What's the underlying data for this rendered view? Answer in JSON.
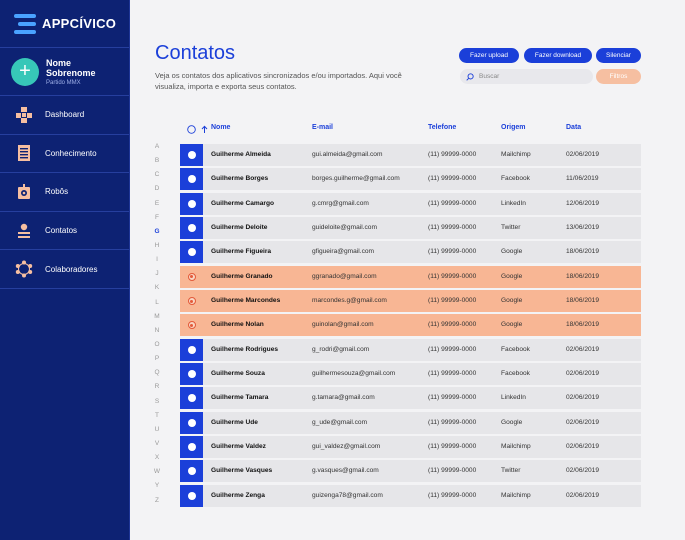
{
  "brand": {
    "name": "APPCÍVICO"
  },
  "profile": {
    "name": "Nome Sobrenome",
    "party": "Partido MMX"
  },
  "nav": [
    {
      "label": "Dashboard",
      "icon": "dashboard-icon"
    },
    {
      "label": "Conhecimento",
      "icon": "document-icon"
    },
    {
      "label": "Robôs",
      "icon": "robot-icon"
    },
    {
      "label": "Contatos",
      "icon": "contacts-icon"
    },
    {
      "label": "Colaboradores",
      "icon": "network-icon"
    }
  ],
  "page": {
    "title": "Contatos",
    "description": "Veja os contatos dos aplicativos sincronizados e/ou importados. Aqui você visualiza, importa e exporta seus contatos."
  },
  "actions": {
    "upload": "Fazer upload",
    "download": "Fazer download",
    "mute": "Silenciar",
    "filters": "Filtros"
  },
  "search": {
    "placeholder": "Buscar",
    "value": ""
  },
  "table": {
    "headers": {
      "name": "Nome",
      "email": "E-mail",
      "phone": "Telefone",
      "origin": "Origem",
      "date": "Data"
    },
    "sort_icon": "arrow-up-icon",
    "rows": [
      {
        "name": "Guilherme Almeida",
        "email": "gui.almeida@gmail.com",
        "phone": "(11) 99999-0000",
        "origin": "Mailchimp",
        "date": "02/06/2019",
        "selected": false
      },
      {
        "name": "Guilherme Borges",
        "email": "borges.guilherme@gmail.com",
        "phone": "(11) 99999-0000",
        "origin": "Facebook",
        "date": "11/06/2019",
        "selected": false
      },
      {
        "name": "Guilherme Camargo",
        "email": "g.cmrg@gmail.com",
        "phone": "(11) 99999-0000",
        "origin": "LinkedIn",
        "date": "12/06/2019",
        "selected": false
      },
      {
        "name": "Guilherme Deloite",
        "email": "guideloite@gmail.com",
        "phone": "(11) 99999-0000",
        "origin": "Twitter",
        "date": "13/06/2019",
        "selected": false
      },
      {
        "name": "Guilherme Figueira",
        "email": "gfigueira@gmail.com",
        "phone": "(11) 99999-0000",
        "origin": "Google",
        "date": "18/06/2019",
        "selected": false
      },
      {
        "name": "Guilherme Granado",
        "email": "ggranado@gmail.com",
        "phone": "(11) 99999-0000",
        "origin": "Google",
        "date": "18/06/2019",
        "selected": true
      },
      {
        "name": "Guilherme Marcondes",
        "email": "marcondes.g@gmail.com",
        "phone": "(11) 99999-0000",
        "origin": "Google",
        "date": "18/06/2019",
        "selected": true
      },
      {
        "name": "Guilherme Nolan",
        "email": "guinolan@gmail.com",
        "phone": "(11) 99999-0000",
        "origin": "Google",
        "date": "18/06/2019",
        "selected": true
      },
      {
        "name": "Guilherme Rodrigues",
        "email": "g_rodri@gmail.com",
        "phone": "(11) 99999-0000",
        "origin": "Facebook",
        "date": "02/06/2019",
        "selected": false
      },
      {
        "name": "Guilherme Souza",
        "email": "guilhermesouza@gmail.com",
        "phone": "(11) 99999-0000",
        "origin": "Facebook",
        "date": "02/06/2019",
        "selected": false
      },
      {
        "name": "Guilherme Tamara",
        "email": "g.tamara@gmail.com",
        "phone": "(11) 99999-0000",
        "origin": "LinkedIn",
        "date": "02/06/2019",
        "selected": false
      },
      {
        "name": "Guilherme Ude",
        "email": "g_ude@gmail.com",
        "phone": "(11) 99999-0000",
        "origin": "Google",
        "date": "02/06/2019",
        "selected": false
      },
      {
        "name": "Guilherme Valdez",
        "email": "gui_valdez@gmail.com",
        "phone": "(11) 99999-0000",
        "origin": "Mailchimp",
        "date": "02/06/2019",
        "selected": false
      },
      {
        "name": "Guilherme Vasques",
        "email": "g.vasques@gmail.com",
        "phone": "(11) 99999-0000",
        "origin": "Twitter",
        "date": "02/06/2019",
        "selected": false
      },
      {
        "name": "Guilherme Zenga",
        "email": "guizenga78@gmail.com",
        "phone": "(11) 99999-0000",
        "origin": "Mailchimp",
        "date": "02/06/2019",
        "selected": false
      }
    ]
  },
  "alphabet": [
    "A",
    "B",
    "C",
    "D",
    "E",
    "F",
    "G",
    "H",
    "I",
    "J",
    "K",
    "L",
    "M",
    "N",
    "O",
    "P",
    "Q",
    "R",
    "S",
    "T",
    "U",
    "V",
    "X",
    "W",
    "Y",
    "Z"
  ],
  "alphabet_active": "G",
  "colors": {
    "sidebar": "#0d2273",
    "accent": "#1b3fd9",
    "selected_row": "#f8b694",
    "avatar": "#37c7b8",
    "icon_peach": "#f6bfa1"
  }
}
